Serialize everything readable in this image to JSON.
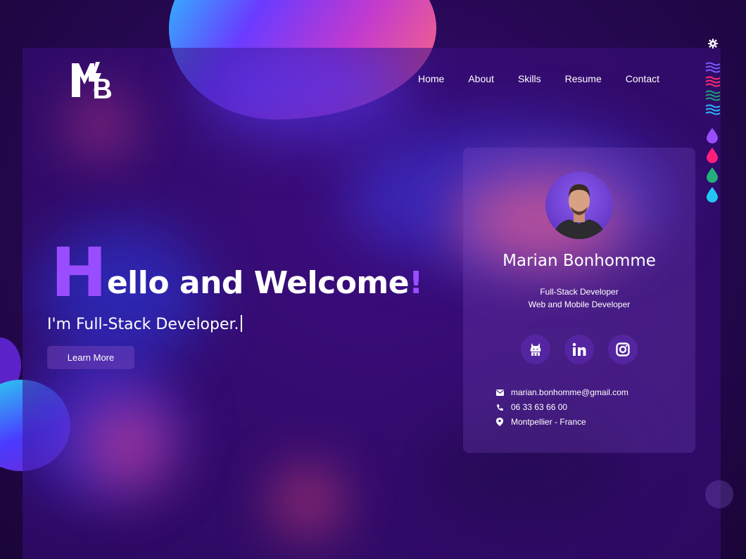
{
  "logo": {
    "text": "MB"
  },
  "nav": {
    "items": [
      "Home",
      "About",
      "Skills",
      "Resume",
      "Contact"
    ]
  },
  "hero": {
    "title_first_letter": "H",
    "title_rest": "ello and Welcome",
    "title_end": "!",
    "subtitle": "I'm Full-Stack Developer.",
    "cta_label": "Learn More"
  },
  "profile": {
    "name": "Marian Bonhomme",
    "roles": [
      "Full-Stack Developer",
      "Web and Mobile Developer"
    ],
    "socials": [
      "github-icon",
      "linkedin-icon",
      "instagram-icon"
    ],
    "contact": {
      "email": "marian.bonhomme@gmail.com",
      "phone": "06 33 63 66 00",
      "location": "Montpellier - France"
    }
  },
  "theme_switcher": {
    "settings_icon": "gear-icon",
    "wave_colors": [
      "#7a5cff",
      "#ff2d6b",
      "#1aa37a",
      "#2ab8ff"
    ],
    "drop_colors": [
      "#9a4dff",
      "#ff1f7a",
      "#23b07a",
      "#22c6f2"
    ]
  },
  "colors": {
    "accent": "#9a4dff",
    "background": "#260852"
  }
}
